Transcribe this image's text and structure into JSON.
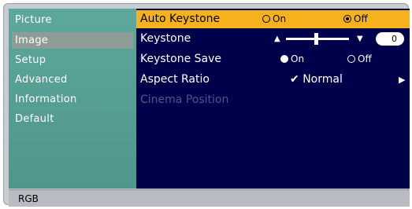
{
  "sidebar": {
    "items": [
      {
        "label": "Picture"
      },
      {
        "label": "Image"
      },
      {
        "label": "Setup"
      },
      {
        "label": "Advanced"
      },
      {
        "label": "Information"
      },
      {
        "label": "Default"
      }
    ],
    "selected": "Image"
  },
  "settings": {
    "auto_keystone": {
      "label": "Auto Keystone",
      "on": "On",
      "off": "Off",
      "selected": "Off"
    },
    "keystone": {
      "label": "Keystone",
      "value": "0",
      "slider_fraction": 0.45
    },
    "keystone_save": {
      "label": "Keystone Save",
      "on": "On",
      "off": "Off",
      "selected": "On"
    },
    "aspect_ratio": {
      "label": "Aspect Ratio",
      "value": "Normal",
      "check": "✔",
      "arrow": "▶"
    },
    "cinema_position": {
      "label": "Cinema Position"
    }
  },
  "status_bar": {
    "source": "RGB"
  },
  "colors": {
    "highlight": "#f5b21d",
    "content_bg": "#00004b",
    "sidebar_bg": "#5da79c",
    "disabled_text": "#505489"
  }
}
